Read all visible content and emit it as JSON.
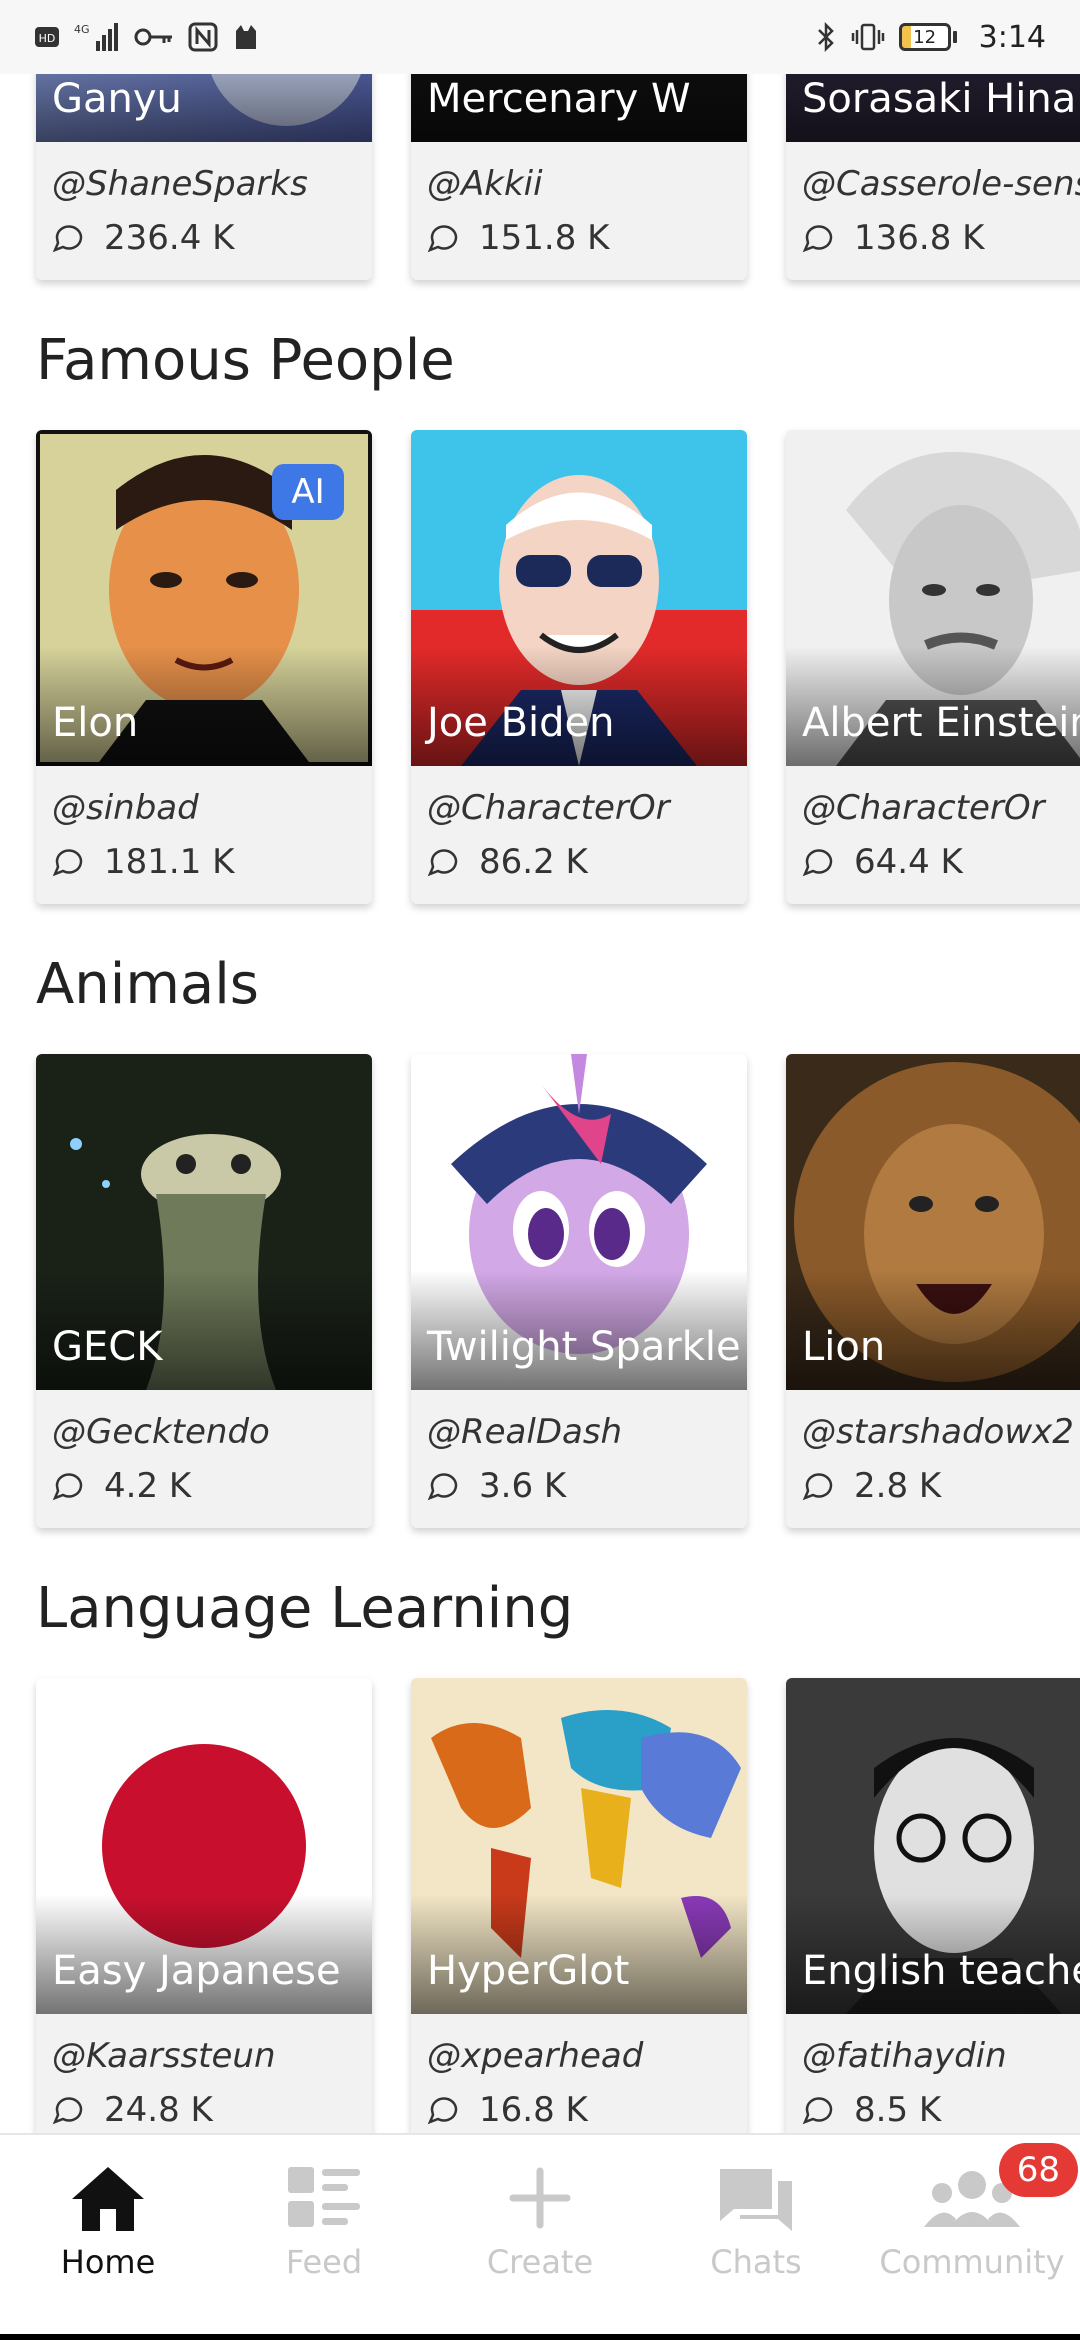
{
  "status_bar": {
    "time": "3:14",
    "battery": "12"
  },
  "sections": [
    {
      "title": "",
      "cards": [
        {
          "name": "Ganyu",
          "author": "@ShaneSparks",
          "count": "236.4 K"
        },
        {
          "name": "Mercenary W",
          "author": "@Akkii",
          "count": "151.8 K"
        },
        {
          "name": "Sorasaki Hina",
          "author": "@Casserole-sens",
          "count": "136.8 K"
        }
      ]
    },
    {
      "title": "Famous People",
      "cards": [
        {
          "name": "Elon",
          "author": "@sinbad",
          "count": "181.1 K",
          "badge": "AI"
        },
        {
          "name": "Joe Biden",
          "author": "@CharacterOr",
          "count": "86.2 K"
        },
        {
          "name": "Albert Einstein",
          "author": "@CharacterOr",
          "count": "64.4 K"
        }
      ]
    },
    {
      "title": "Animals",
      "cards": [
        {
          "name": "GECK",
          "author": "@Gecktendo",
          "count": "4.2 K"
        },
        {
          "name": "Twilight Sparkle",
          "author": "@RealDash",
          "count": "3.6 K"
        },
        {
          "name": "Lion",
          "author": "@starshadowx2",
          "count": "2.8 K"
        }
      ]
    },
    {
      "title": "Language Learning",
      "cards": [
        {
          "name": "Easy Japanese",
          "author": "@Kaarssteun",
          "count": "24.8 K"
        },
        {
          "name": "HyperGlot",
          "author": "@xpearhead",
          "count": "16.8 K"
        },
        {
          "name": "English teache",
          "author": "@fatihaydin",
          "count": "8.5 K"
        }
      ]
    }
  ],
  "bottom_nav": {
    "items": [
      {
        "label": "Home",
        "icon": "home-icon",
        "active": true
      },
      {
        "label": "Feed",
        "icon": "feed-icon"
      },
      {
        "label": "Create",
        "icon": "plus-icon"
      },
      {
        "label": "Chats",
        "icon": "chat-icon"
      },
      {
        "label": "Community",
        "icon": "community-icon",
        "badge": "68"
      }
    ]
  },
  "colors": {
    "accent": "#3d78e6",
    "badge": "#e53935",
    "inactive": "#c9c9c9"
  }
}
